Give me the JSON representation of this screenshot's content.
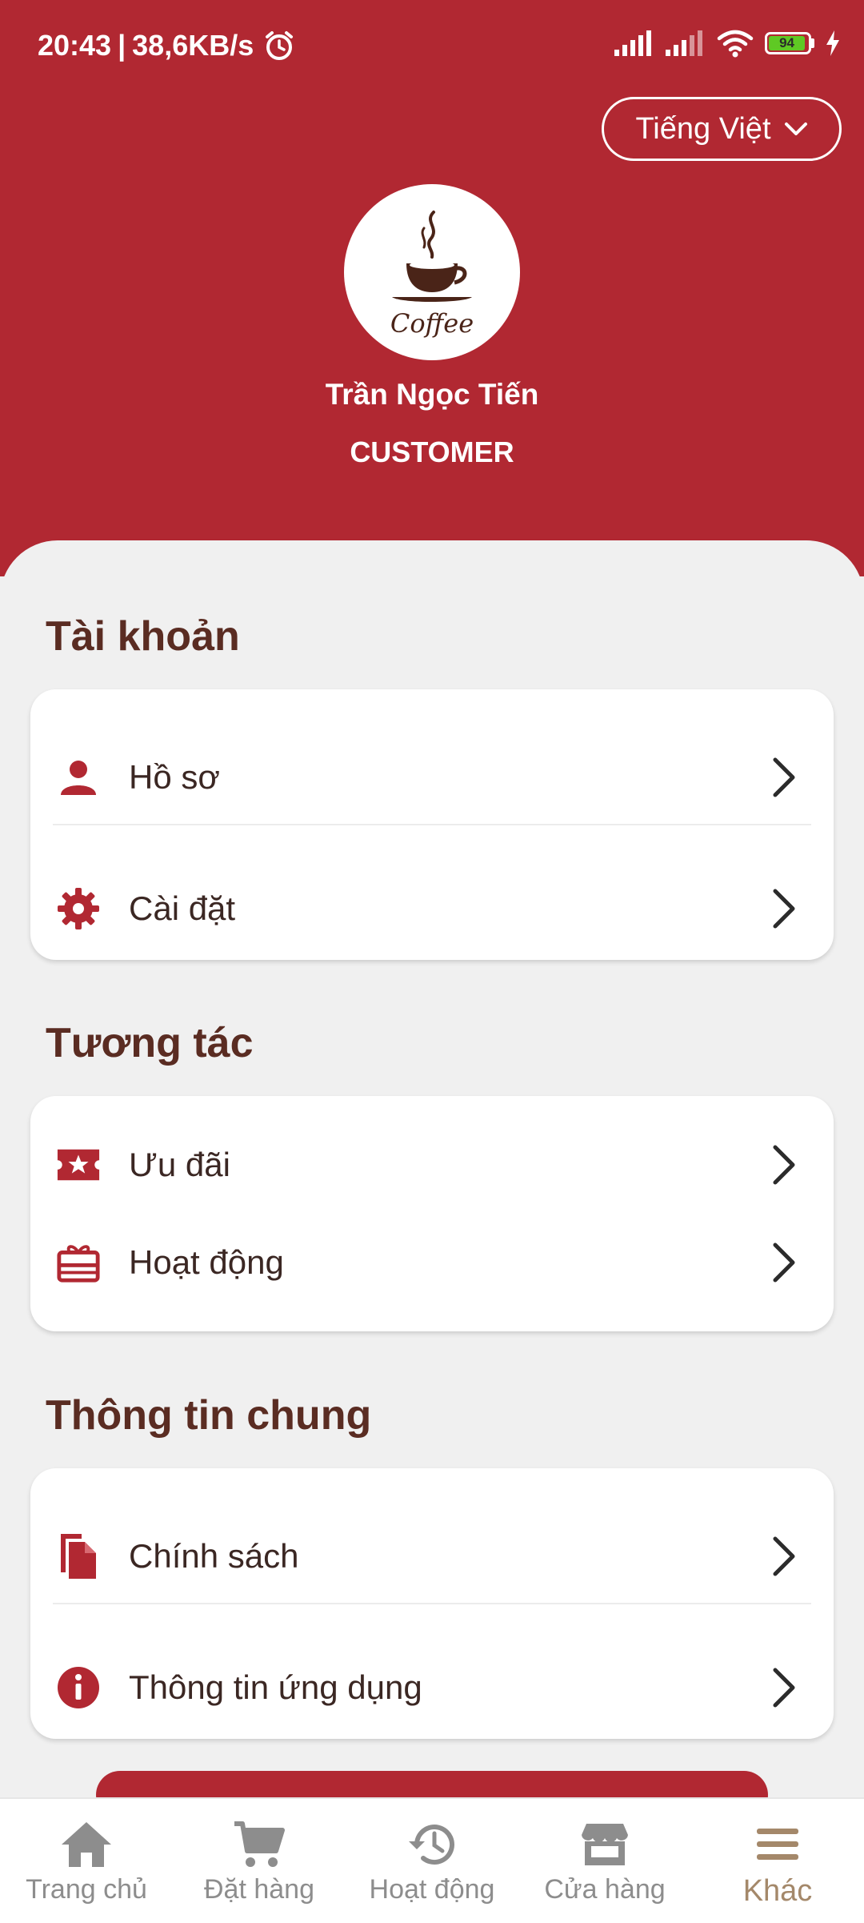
{
  "status_bar": {
    "time": "20:43",
    "separator": "|",
    "network_speed": "38,6KB/s",
    "battery": "94",
    "battery_color": "#5fc924"
  },
  "language": {
    "label": "Tiếng Việt"
  },
  "profile": {
    "avatar_icon": "coffee-cup-logo",
    "name": "Trần Ngọc Tiến",
    "role": "CUSTOMER"
  },
  "sections": {
    "account": {
      "title": "Tài khoản",
      "items": [
        {
          "icon": "person-icon",
          "label": "Hồ sơ"
        },
        {
          "icon": "gear-icon",
          "label": "Cài đặt"
        }
      ]
    },
    "interaction": {
      "title": "Tương tác",
      "items": [
        {
          "icon": "ticket-star-icon",
          "label": "Ưu đãi"
        },
        {
          "icon": "gift-card-icon",
          "label": "Hoạt động"
        }
      ]
    },
    "general": {
      "title": "Thông tin chung",
      "items": [
        {
          "icon": "document-icon",
          "label": "Chính sách"
        },
        {
          "icon": "info-icon",
          "label": "Thông tin ứng dụng"
        }
      ]
    }
  },
  "bottom_nav": {
    "items": [
      {
        "icon": "home-icon",
        "label": "Trang chủ"
      },
      {
        "icon": "cart-icon",
        "label": "Đặt hàng"
      },
      {
        "icon": "history-icon",
        "label": "Hoạt động"
      },
      {
        "icon": "store-icon",
        "label": "Cửa hàng"
      },
      {
        "icon": "menu-icon",
        "label": "Khác"
      }
    ],
    "active_index": 4
  },
  "colors": {
    "brand_red": "#b12832",
    "title_brown": "#5a2c22",
    "active_nav": "#a4886a",
    "inactive_nav": "#8d8d8d"
  }
}
